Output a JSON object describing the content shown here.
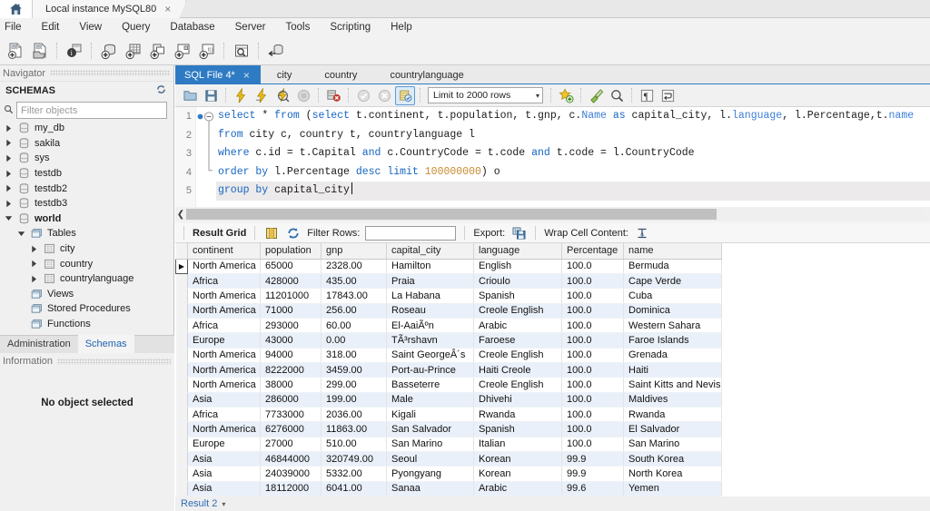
{
  "window": {
    "home_icon": "home-icon",
    "instance_tab": "Local instance MySQL80",
    "close_glyph": "×"
  },
  "menubar": {
    "items": [
      "File",
      "Edit",
      "View",
      "Query",
      "Database",
      "Server",
      "Tools",
      "Scripting",
      "Help"
    ]
  },
  "main_toolbar": {
    "buttons": [
      {
        "name": "new-sql-tab-icon",
        "title": "Create a new SQL tab"
      },
      {
        "name": "open-sql-script-icon",
        "title": "Open a SQL script file"
      },
      {
        "name": "connection-info-icon",
        "title": "Connect to database"
      },
      {
        "name": "new-schema-icon",
        "title": "Create a new schema"
      },
      {
        "name": "new-table-icon",
        "title": "Create a new table"
      },
      {
        "name": "new-view-icon",
        "title": "Create a new view"
      },
      {
        "name": "new-procedure-icon",
        "title": "Create a new stored procedure"
      },
      {
        "name": "new-function-icon",
        "title": "Create a new function"
      },
      {
        "name": "inspector-icon",
        "title": "Schema inspector"
      },
      {
        "name": "reconnect-icon",
        "title": "Reconnect to DBMS"
      }
    ]
  },
  "navigator": {
    "caption": "Navigator",
    "schemas_header": "SCHEMAS",
    "refresh_icon": "refresh-icon",
    "filter_placeholder": "Filter objects",
    "filter_value": "",
    "search_icon": "search-icon",
    "tree": [
      {
        "label": "my_db",
        "icon": "schema-icon",
        "indent": 0,
        "expanded": false,
        "arrow": true,
        "bold": false
      },
      {
        "label": "sakila",
        "icon": "schema-icon",
        "indent": 0,
        "expanded": false,
        "arrow": true,
        "bold": false
      },
      {
        "label": "sys",
        "icon": "schema-icon",
        "indent": 0,
        "expanded": false,
        "arrow": true,
        "bold": false
      },
      {
        "label": "testdb",
        "icon": "schema-icon",
        "indent": 0,
        "expanded": false,
        "arrow": true,
        "bold": false
      },
      {
        "label": "testdb2",
        "icon": "schema-icon",
        "indent": 0,
        "expanded": false,
        "arrow": true,
        "bold": false
      },
      {
        "label": "testdb3",
        "icon": "schema-icon",
        "indent": 0,
        "expanded": false,
        "arrow": true,
        "bold": false
      },
      {
        "label": "world",
        "icon": "schema-icon",
        "indent": 0,
        "expanded": true,
        "arrow": true,
        "bold": true
      },
      {
        "label": "Tables",
        "icon": "folder-icon",
        "indent": 1,
        "expanded": true,
        "arrow": true,
        "bold": false
      },
      {
        "label": "city",
        "icon": "table-icon",
        "indent": 2,
        "expanded": false,
        "arrow": true,
        "bold": false
      },
      {
        "label": "country",
        "icon": "table-icon",
        "indent": 2,
        "expanded": false,
        "arrow": true,
        "bold": false
      },
      {
        "label": "countrylanguage",
        "icon": "table-icon",
        "indent": 2,
        "expanded": false,
        "arrow": true,
        "bold": false
      },
      {
        "label": "Views",
        "icon": "folder-icon",
        "indent": 1,
        "expanded": false,
        "arrow": false,
        "bold": false
      },
      {
        "label": "Stored Procedures",
        "icon": "folder-icon",
        "indent": 1,
        "expanded": false,
        "arrow": false,
        "bold": false
      },
      {
        "label": "Functions",
        "icon": "folder-icon",
        "indent": 1,
        "expanded": false,
        "arrow": false,
        "bold": false
      }
    ],
    "bottom_tabs": [
      {
        "label": "Administration",
        "active": false
      },
      {
        "label": "Schemas",
        "active": true
      }
    ],
    "information_caption": "Information",
    "no_object_selected": "No object selected"
  },
  "editor": {
    "tabs": [
      {
        "label": "SQL File 4*",
        "active": true,
        "closable": true
      },
      {
        "label": "city",
        "active": false,
        "closable": false
      },
      {
        "label": "country",
        "active": false,
        "closable": false
      },
      {
        "label": "countrylanguage",
        "active": false,
        "closable": false
      }
    ],
    "toolbar": {
      "buttons": [
        {
          "name": "open-script-icon",
          "title": "Open a script file in this editor"
        },
        {
          "name": "save-script-icon",
          "title": "Save the script to a file"
        },
        {
          "name": "execute-statement-icon",
          "title": "Execute the selected portion of the script"
        },
        {
          "name": "execute-current-statement-icon",
          "title": "Execute the statement under the keyboard cursor"
        },
        {
          "name": "explain-query-icon",
          "title": "Execute Explain statement"
        },
        {
          "name": "stop-execution-icon",
          "title": "Stop the query being executed"
        },
        {
          "name": "toggle-stop-on-error-icon",
          "title": "Toggle whether execution should stop on errors"
        },
        {
          "name": "commit-icon",
          "title": "Commit the current transaction"
        },
        {
          "name": "rollback-icon",
          "title": "Rollback the current transaction"
        },
        {
          "name": "toggle-autocommit-icon",
          "title": "Toggle autocommit mode"
        },
        {
          "name": "beautify-sql-icon",
          "title": "Beautify/reformat the SQL script"
        },
        {
          "name": "find-icon",
          "title": "Show the Find panel"
        },
        {
          "name": "toggle-invisible-chars-icon",
          "title": "Toggle invisible characters"
        },
        {
          "name": "toggle-wrapping-icon",
          "title": "Toggle wrapping of long lines"
        }
      ],
      "snippet_icon": "snippet-star-icon",
      "limit_label": "Limit to 2000 rows",
      "limit_caret": "▾"
    },
    "lines": [
      {
        "no": "1",
        "current": false,
        "has_breakpoint": true,
        "fold": "open"
      },
      {
        "no": "2",
        "current": false,
        "has_breakpoint": false,
        "fold": "mid"
      },
      {
        "no": "3",
        "current": false,
        "has_breakpoint": false,
        "fold": "mid"
      },
      {
        "no": "4",
        "current": false,
        "has_breakpoint": false,
        "fold": "end"
      },
      {
        "no": "5",
        "current": true,
        "has_breakpoint": false,
        "fold": "none"
      }
    ],
    "code": {
      "line1": "select * from (select t.continent, t.population, t.gnp, c.Name as capital_city, l.language, l.Percentage,t.name",
      "line2": "from city c, country t, countrylanguage l",
      "line3": "where c.id = t.Capital and c.CountryCode = t.code and t.code = l.CountryCode",
      "line4": "order by l.Percentage desc limit 100000000) o",
      "line5": "group by capital_city"
    }
  },
  "results": {
    "toolbar": {
      "result_grid_label": "Result Grid",
      "grid-view-icon": "grid-view-icon",
      "refresh-icon": "refresh-icon",
      "filter_rows_label": "Filter Rows:",
      "filter_rows_value": "",
      "export_label": "Export:",
      "export-icon": "export-icon",
      "wrap_cell_label": "Wrap Cell Content:",
      "wrap-cell-icon": "wrap-cell-icon"
    },
    "columns": [
      "continent",
      "population",
      "gnp",
      "capital_city",
      "language",
      "Percentage",
      "name"
    ],
    "rows": [
      [
        "North America",
        "65000",
        "2328.00",
        "Hamilton",
        "English",
        "100.0",
        "Bermuda"
      ],
      [
        "Africa",
        "428000",
        "435.00",
        "Praia",
        "Crioulo",
        "100.0",
        "Cape Verde"
      ],
      [
        "North America",
        "11201000",
        "17843.00",
        "La Habana",
        "Spanish",
        "100.0",
        "Cuba"
      ],
      [
        "North America",
        "71000",
        "256.00",
        "Roseau",
        "Creole English",
        "100.0",
        "Dominica"
      ],
      [
        "Africa",
        "293000",
        "60.00",
        "El-AaiÃºn",
        "Arabic",
        "100.0",
        "Western Sahara"
      ],
      [
        "Europe",
        "43000",
        "0.00",
        "TÃ³rshavn",
        "Faroese",
        "100.0",
        "Faroe Islands"
      ],
      [
        "North America",
        "94000",
        "318.00",
        "Saint GeorgeÂ´s",
        "Creole English",
        "100.0",
        "Grenada"
      ],
      [
        "North America",
        "8222000",
        "3459.00",
        "Port-au-Prince",
        "Haiti Creole",
        "100.0",
        "Haiti"
      ],
      [
        "North America",
        "38000",
        "299.00",
        "Basseterre",
        "Creole English",
        "100.0",
        "Saint Kitts and Nevis"
      ],
      [
        "Asia",
        "286000",
        "199.00",
        "Male",
        "Dhivehi",
        "100.0",
        "Maldives"
      ],
      [
        "Africa",
        "7733000",
        "2036.00",
        "Kigali",
        "Rwanda",
        "100.0",
        "Rwanda"
      ],
      [
        "North America",
        "6276000",
        "11863.00",
        "San Salvador",
        "Spanish",
        "100.0",
        "El Salvador"
      ],
      [
        "Europe",
        "27000",
        "510.00",
        "San Marino",
        "Italian",
        "100.0",
        "San Marino"
      ],
      [
        "Asia",
        "46844000",
        "320749.00",
        "Seoul",
        "Korean",
        "99.9",
        "South Korea"
      ],
      [
        "Asia",
        "24039000",
        "5332.00",
        "Pyongyang",
        "Korean",
        "99.9",
        "North Korea"
      ],
      [
        "Asia",
        "18112000",
        "6041.00",
        "Sanaa",
        "Arabic",
        "99.6",
        "Yemen"
      ]
    ],
    "selected_row_index": 0,
    "row_marker_glyph": "▶",
    "bottom_tab": "Result 2",
    "bottom_tab_caret": "▾"
  },
  "colors": {
    "accent_blue": "#2e7bc4",
    "keyword_blue": "#1565c0",
    "number_orange": "#c98a2e",
    "alt_row": "#eaf0f9",
    "toolbar_bg": "#f1f1f1"
  }
}
